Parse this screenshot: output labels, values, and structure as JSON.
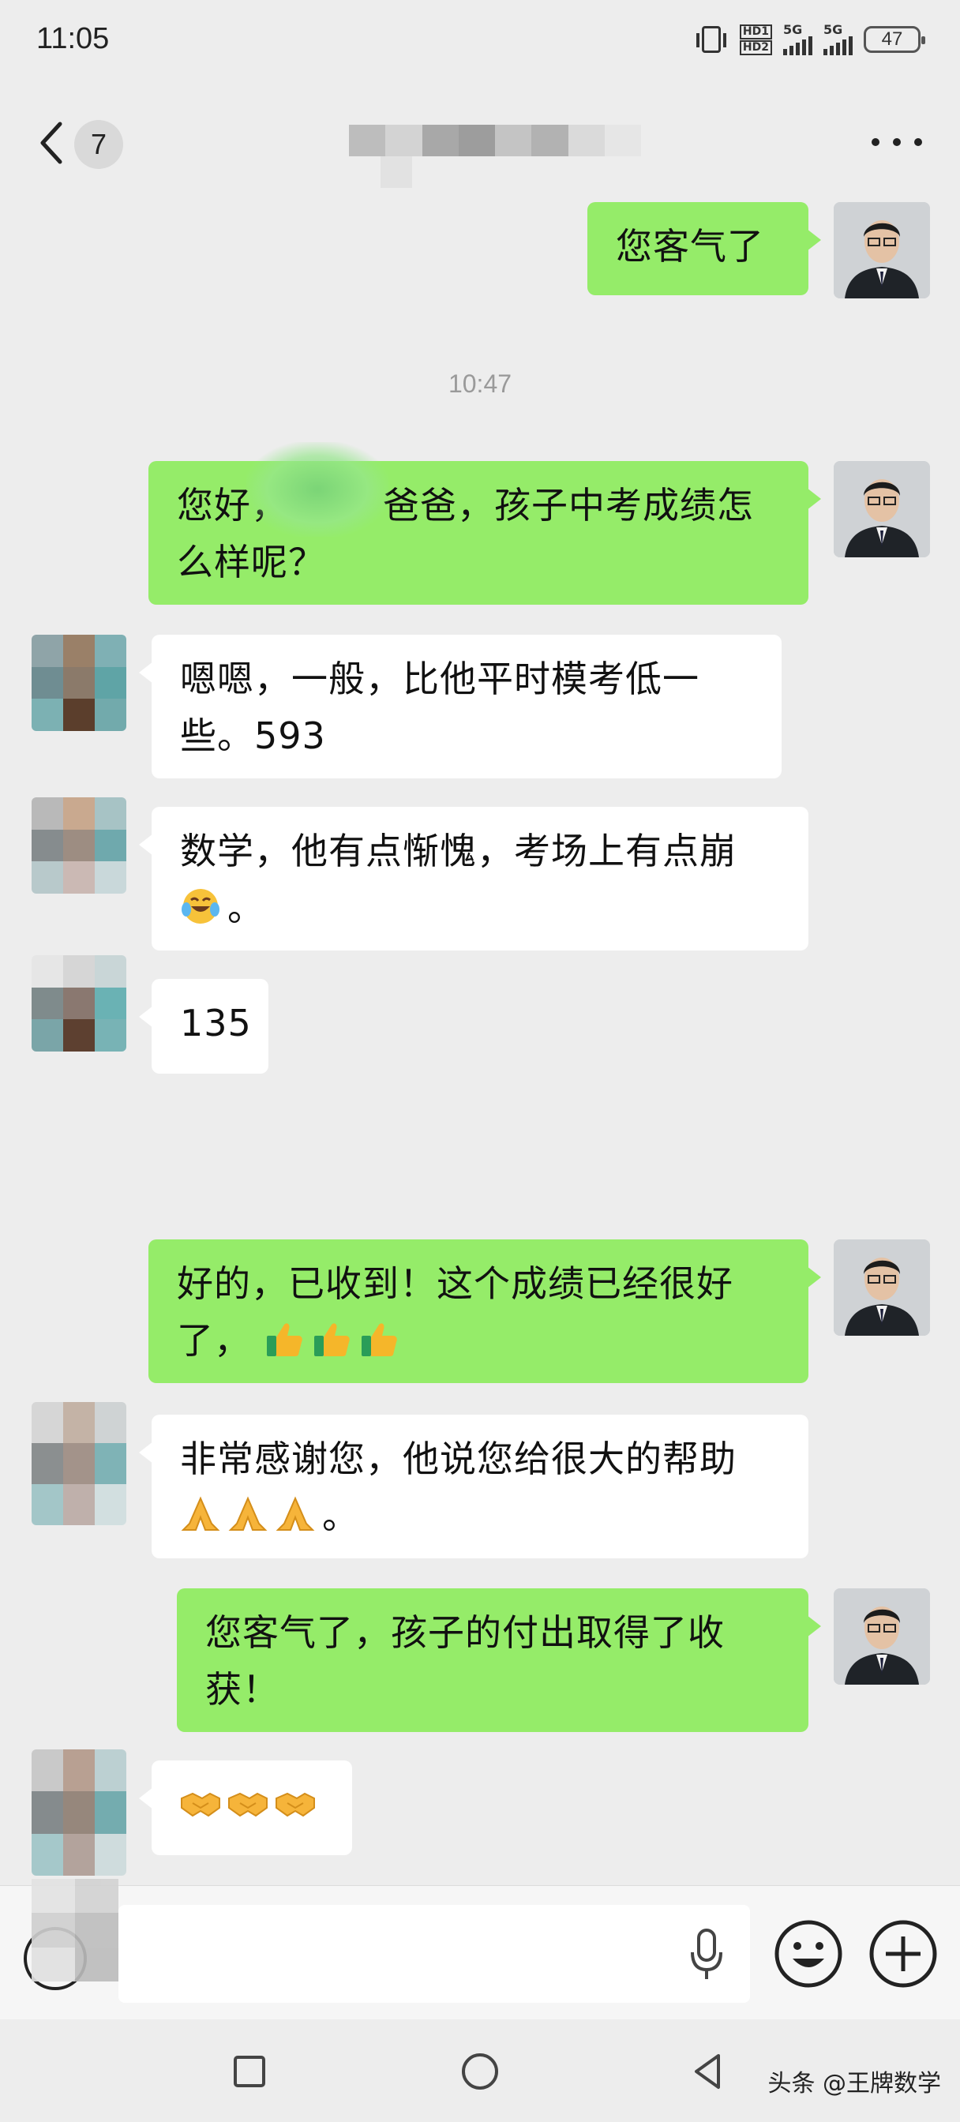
{
  "status_bar": {
    "time": "11:05",
    "hd_label_1": "HD1",
    "hd_label_2": "HD2",
    "net1": "5G",
    "net2": "5G",
    "battery": "47"
  },
  "nav": {
    "unread_count": "7",
    "icons": [
      "chevron-left-icon",
      "more-icon"
    ]
  },
  "chat": {
    "timestamp": "10:47",
    "messages": [
      {
        "from": "me",
        "text": "您客气了"
      },
      {
        "from": "me",
        "line1": "您好，",
        "line1b": "爸爸，孩子中考成绩怎",
        "line2": "么样呢？"
      },
      {
        "from": "other",
        "line1": "嗯嗯，一般，比他平时模考低一",
        "line2": "些。593"
      },
      {
        "from": "other",
        "line1": "数学，他有点惭愧，考场上有点崩",
        "line2": "。",
        "emoji": [
          "face-with-tears-of-joy-emoji"
        ]
      },
      {
        "from": "other",
        "text": "135"
      },
      {
        "from": "me",
        "line1": "好的，已收到！这个成绩已经很好",
        "line2": "了，",
        "emoji": [
          "thumbs-up-emoji",
          "thumbs-up-emoji",
          "thumbs-up-emoji"
        ]
      },
      {
        "from": "other",
        "line1": "非常感谢您，他说您给很大的帮助",
        "line2": "。",
        "emoji": [
          "folded-hands-emoji",
          "folded-hands-emoji",
          "folded-hands-emoji"
        ]
      },
      {
        "from": "me",
        "line1": "您客气了，孩子的付出取得了收",
        "line2": "获！"
      },
      {
        "from": "other",
        "emoji": [
          "handshake-emoji",
          "handshake-emoji",
          "handshake-emoji"
        ]
      }
    ]
  },
  "input_bar": {
    "placeholder": "",
    "icons": [
      "voice-toggle-icon",
      "microphone-icon",
      "emoji-icon",
      "plus-icon"
    ]
  },
  "system_nav": {
    "watermark": "头条 @王牌数学",
    "icons": [
      "recents-square-icon",
      "home-circle-icon",
      "back-triangle-icon"
    ]
  },
  "colors": {
    "background": "#ededed",
    "outgoing_bubble": "#95ec69",
    "incoming_bubble": "#ffffff",
    "timestamp": "#9a9a9a"
  }
}
